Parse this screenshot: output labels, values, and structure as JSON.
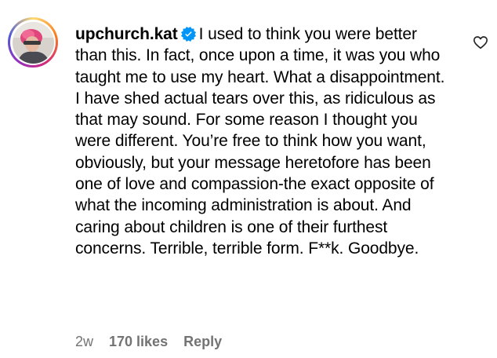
{
  "comment": {
    "username": "upchurch.kat",
    "verified_icon": "verified-badge-icon",
    "text": "I used to think you were better than this. In fact, once upon a time, it was you who taught me to use my heart. What a disappointment. I have shed actual tears over this, as ridiculous as that may sound. For some reason I thought you were different. You’re free to think how you want, obviously, but your message heretofore has been one of love and compassion-the exact opposite of what the incoming administration is about. And caring about children is one of their furthest concerns. Terrible, terrible form. F**k. Goodbye.",
    "time": "2w",
    "likes": "170 likes",
    "reply_label": "Reply",
    "like_icon": "heart-outline-icon"
  },
  "colors": {
    "text": "#000000",
    "meta": "#737373",
    "verified": "#0095f6"
  }
}
